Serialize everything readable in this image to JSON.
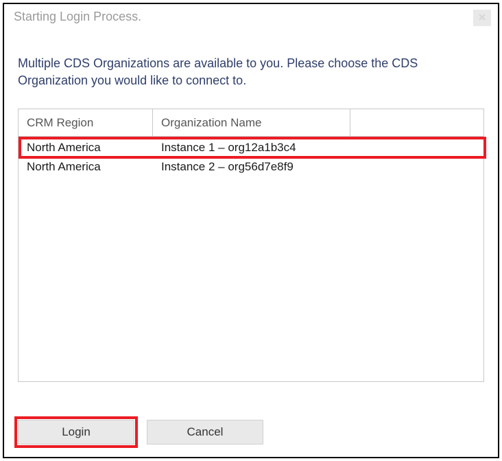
{
  "window": {
    "title": "Starting Login Process.",
    "close_label": "Close"
  },
  "instructions": "Multiple CDS Organizations are available to you. Please choose the CDS Organization you would like to connect to.",
  "table": {
    "headers": {
      "col1": "CRM Region",
      "col2": "Organization Name",
      "col3": ""
    },
    "rows": [
      {
        "region": "North America",
        "org": "Instance 1 – org12a1b3c4"
      },
      {
        "region": "North America",
        "org": "Instance 2 – org56d7e8f9"
      }
    ]
  },
  "buttons": {
    "login": "Login",
    "cancel": "Cancel"
  }
}
